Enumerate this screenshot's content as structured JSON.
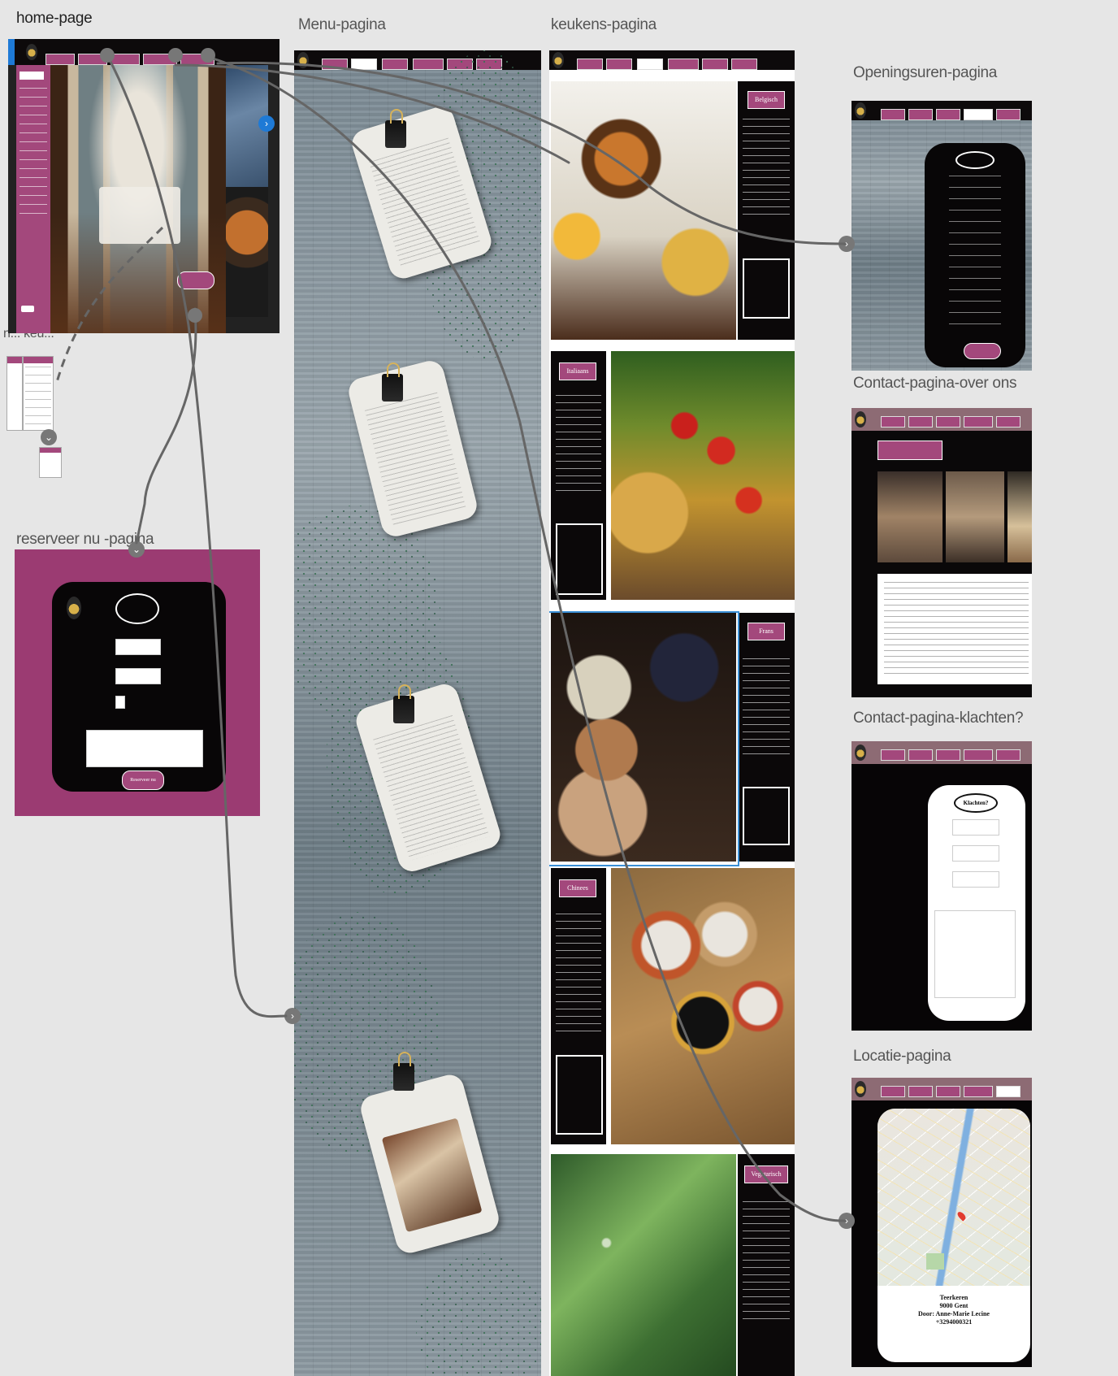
{
  "labels": {
    "home": "home-page",
    "menu": "Menu-pagina",
    "keukens": "keukens-pagina",
    "openingsuren": "Openingsuren-pagina",
    "reserveer": "reserveer nu -pagina",
    "contact_over": "Contact-pagina-over ons",
    "contact_klachten": "Contact-pagina-klachten?",
    "locatie": "Locatie-pagina",
    "fragment": "n... keu..."
  },
  "keukens_panels": [
    "Belgisch",
    "Italiaans",
    "Frans",
    "Chinees",
    "Vegetarisch"
  ],
  "reserveer": {
    "button": "Reserveer nu"
  },
  "klachten": {
    "title": "Klachten?"
  },
  "locatie": {
    "address_lines": [
      "Teerkeren",
      "9000 Gent",
      "Door: Anne-Marie Lecine",
      "+3294000321"
    ]
  },
  "colors": {
    "accent": "#a3487c",
    "panel_black": "#0b0809",
    "canvas": "#e6e6e6",
    "wire": "#666666"
  },
  "icons": [
    "chevron-right-icon",
    "chevron-down-icon",
    "logo-icon"
  ]
}
